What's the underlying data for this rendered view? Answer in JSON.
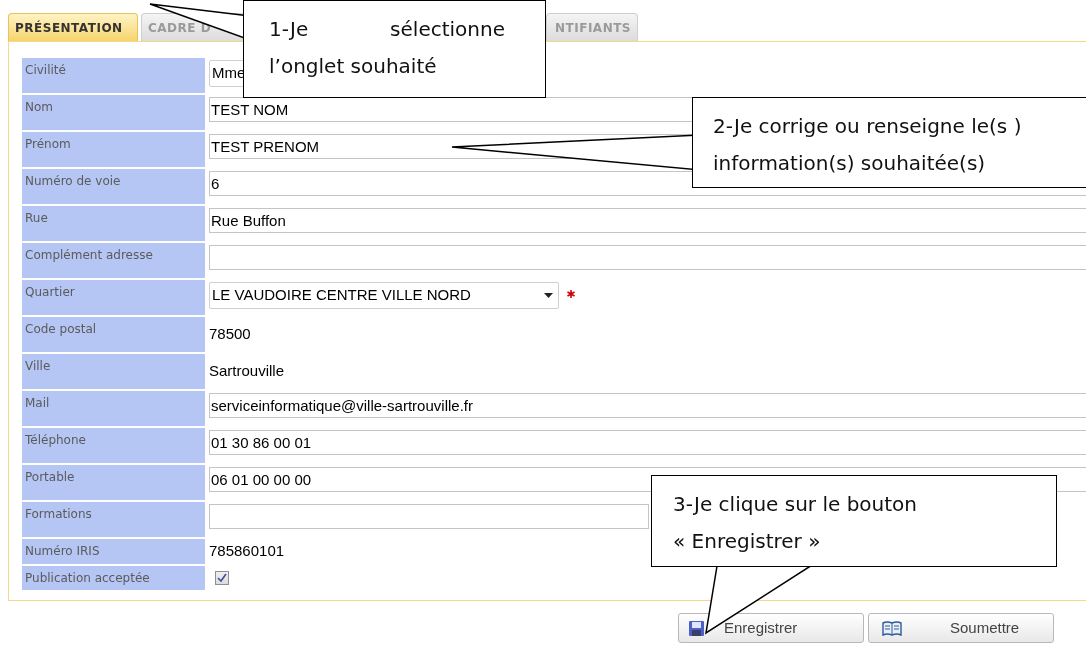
{
  "tabs": [
    {
      "label": "PRÉSENTATION",
      "selected": true
    },
    {
      "label": "CADRE D",
      "selected": false
    },
    {
      "label": "NTIFIANTS",
      "selected": false
    }
  ],
  "fields": [
    {
      "label": "Civilité",
      "kind": "select",
      "value": "Mme",
      "required": false
    },
    {
      "label": "Nom",
      "kind": "text",
      "value": "TEST NOM",
      "required": false
    },
    {
      "label": "Prénom",
      "kind": "text",
      "value": "TEST PRENOM",
      "required": false
    },
    {
      "label": "Numéro de voie",
      "kind": "text",
      "value": "6",
      "required": false
    },
    {
      "label": "Rue",
      "kind": "text",
      "value": "Rue Buffon",
      "required": false
    },
    {
      "label": "Complément adresse",
      "kind": "text",
      "required": false
    },
    {
      "label": "Quartier",
      "kind": "select",
      "value": "LE VAUDOIRE CENTRE VILLE NORD",
      "required": true
    },
    {
      "label": "Code postal",
      "kind": "static",
      "value": "78500",
      "required": false
    },
    {
      "label": "Ville",
      "kind": "static",
      "value": "Sartrouville",
      "required": false
    },
    {
      "label": "Mail",
      "kind": "text",
      "value": "serviceinformatique@ville-sartrouville.fr",
      "required": false
    },
    {
      "label": "Téléphone",
      "kind": "text",
      "value": "01 30 86 00 01",
      "required": false
    },
    {
      "label": "Portable",
      "kind": "text",
      "value": "06 01 00 00 00",
      "required": false
    },
    {
      "label": "Formations",
      "kind": "text",
      "required": false
    },
    {
      "label": "Numéro IRIS",
      "kind": "static",
      "value": "785860101",
      "required": false
    },
    {
      "label": "Publication acceptée",
      "kind": "checkbox",
      "checked": true,
      "required": false
    }
  ],
  "buttons": [
    {
      "label": "Enregistrer",
      "kind": "save"
    },
    {
      "label": "Soumettre",
      "kind": "submit"
    }
  ],
  "callouts": [
    {
      "text": "1-Je sélectionne l’onglet souhaité"
    },
    {
      "text": "2-Je corrige ou renseigne le(s ) information(s) souhaitée(s)"
    },
    {
      "text": "3-Je clique sur le bouton « Enregistrer »"
    }
  ]
}
